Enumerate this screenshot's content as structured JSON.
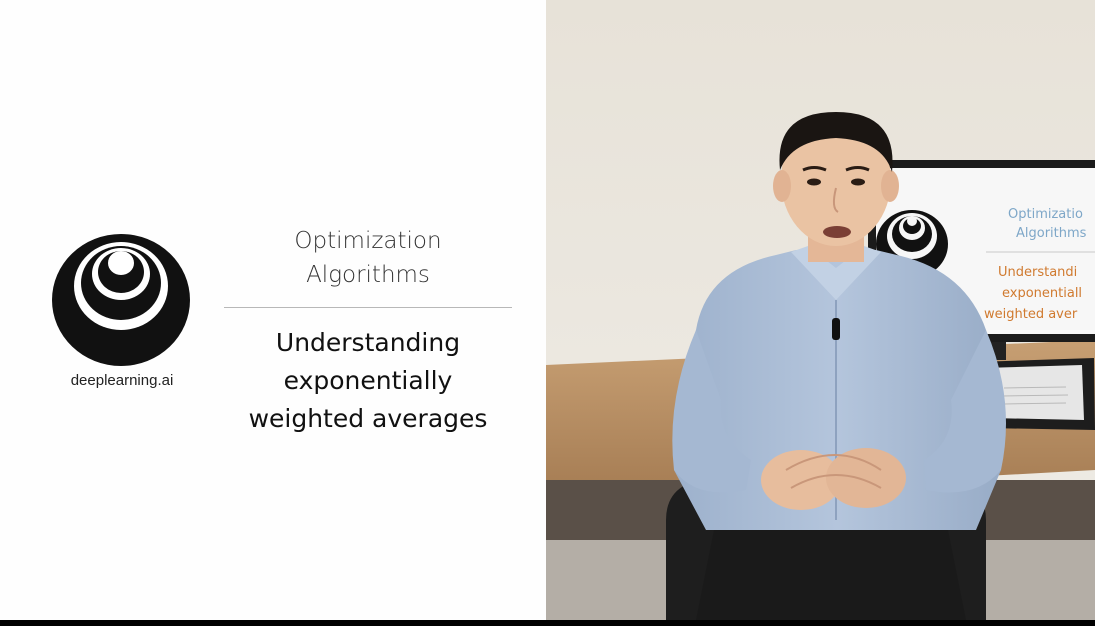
{
  "slide": {
    "logo_caption": "deeplearning.ai",
    "course_title_lines": [
      "Optimization",
      "Algorithms"
    ],
    "lesson_title_lines": [
      "Understanding",
      "exponentially",
      "weighted averages"
    ]
  },
  "video": {
    "monitor_course_lines": [
      "Optimizatio",
      "Algorithms"
    ],
    "monitor_lesson_lines": [
      "Understandi",
      "exponentiall",
      "weighted aver"
    ]
  },
  "colors": {
    "slide_background": "#fefefe",
    "logo": "#111111",
    "shirt": "#a9bcd6",
    "wall": "#ece9e2"
  },
  "icons": {
    "logo": "deeplearning-logo-icon"
  }
}
